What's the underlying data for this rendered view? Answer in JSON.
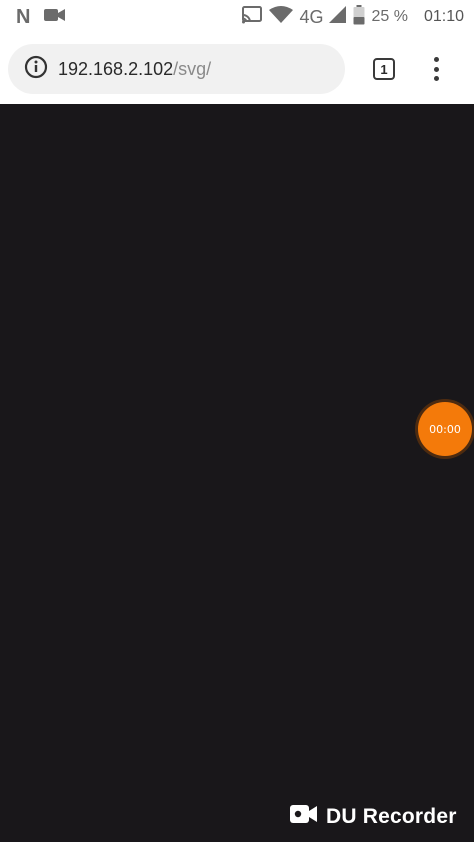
{
  "status_bar": {
    "notif_letter": "N",
    "network": "4G",
    "battery": "25 %",
    "time": "01:10",
    "icons": [
      "cast-icon",
      "wifi-icon",
      "signal-icon",
      "battery-icon",
      "video-camera-icon"
    ]
  },
  "browser": {
    "url_host": "192.168.2.102",
    "url_path": "/svg/",
    "tab_count": "1",
    "icons": [
      "info-icon",
      "tab-switcher-icon",
      "overflow-menu-icon"
    ]
  },
  "recorder_bubble": {
    "time": "00:00",
    "color": "#f47a0a"
  },
  "watermark": {
    "text": "DU Recorder",
    "icon": "camcorder-icon"
  },
  "colors": {
    "page_background": "#19171a",
    "toolbar_background": "#ffffff",
    "url_pill": "#f1f1f1"
  }
}
